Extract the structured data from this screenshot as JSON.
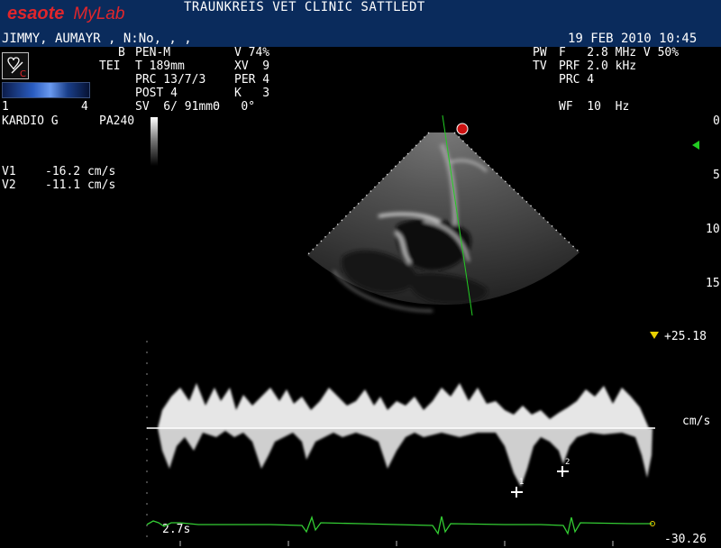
{
  "header": {
    "brand_esaote": "esaote",
    "brand_mylab": "MyLab",
    "clinic": "TRAUNKREIS VET CLINIC SATTLEDT",
    "patient": "JIMMY, AUMAYR , N:No, , ,",
    "datetime": "19 FEB 2010 10:45"
  },
  "probe": {
    "badge": "C"
  },
  "bmode_params": {
    "b": "B",
    "tei": "TEI",
    "pen": "PEN-M",
    "v": "V 74%",
    "t": "T 189mm",
    "xv": "XV  9",
    "prc": "PRC 13/7/3",
    "per": "PER 4",
    "post": "POST 4",
    "k": "K   3",
    "sv": "SV  6/ 91mmΘ   0°"
  },
  "color_scale": {
    "left": "1",
    "right": "4"
  },
  "preset": {
    "exam": "KARDIO G",
    "probe_model": "PA240"
  },
  "measurements": [
    {
      "label": "V1",
      "value": "-16.2 cm/s"
    },
    {
      "label": "V2",
      "value": "-11.1 cm/s"
    }
  ],
  "pw_params": {
    "pw": "PW",
    "tv": "TV",
    "f": "F   2.8 MHz V 50%",
    "prf": "PRF 2.0 kHz",
    "prc": "PRC 4",
    "wf": "WF  10  Hz"
  },
  "depth_scale": {
    "labels": [
      "0",
      "5",
      "10",
      "15"
    ]
  },
  "doppler": {
    "top_scale": "+25.18",
    "unit": "cm/s",
    "bottom_scale": "-30.26",
    "sweep_time": "2.7s",
    "cursor1": "1",
    "cursor2": "2"
  },
  "colors": {
    "title_bg": "#0a2b5c",
    "brand": "#e0262c",
    "ecg": "#33cc33",
    "sample_line": "#22cc22"
  }
}
